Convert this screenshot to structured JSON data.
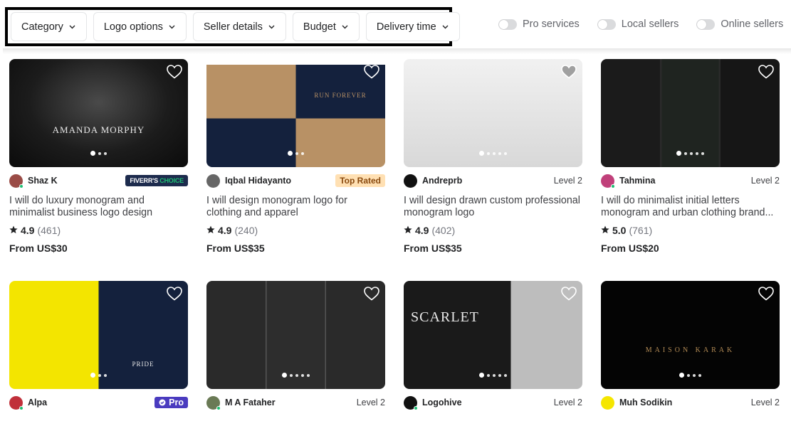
{
  "filters": {
    "buttons": [
      {
        "label": "Category"
      },
      {
        "label": "Logo options"
      },
      {
        "label": "Seller details"
      },
      {
        "label": "Budget"
      },
      {
        "label": "Delivery time"
      }
    ],
    "toggles": [
      {
        "label": "Pro services",
        "on": false
      },
      {
        "label": "Local sellers",
        "on": false
      },
      {
        "label": "Online sellers",
        "on": false
      }
    ]
  },
  "gigs": [
    {
      "seller": "Shaz K",
      "badge_type": "choice",
      "badge": {
        "a": "FIVERR'S",
        "b": "CHOICE"
      },
      "online": true,
      "title": "I will do luxury monogram and minimalist business logo design",
      "rating": "4.9",
      "reviews": "(461)",
      "price": "From US$30",
      "image_text": "AMANDA MORPHY",
      "dots": 3
    },
    {
      "seller": "Iqbal Hidayanto",
      "badge_type": "top",
      "badge": {
        "a": "Top Rated"
      },
      "online": false,
      "title": "I will design monogram logo for clothing and apparel",
      "rating": "4.9",
      "reviews": "(240)",
      "price": "From US$35",
      "image_text": "RUN FOREVER",
      "dots": 3
    },
    {
      "seller": "Andreprb",
      "badge_type": "level",
      "badge": {
        "a": "Level 2"
      },
      "online": false,
      "title": "I will design drawn custom professional monogram logo",
      "rating": "4.9",
      "reviews": "(402)",
      "price": "From US$35",
      "image_text": "",
      "dots": 5
    },
    {
      "seller": "Tahmina",
      "badge_type": "level",
      "badge": {
        "a": "Level 2"
      },
      "online": true,
      "title": "I will do minimalist initial letters monogram and urban clothing brand...",
      "rating": "5.0",
      "reviews": "(761)",
      "price": "From US$20",
      "image_text": "",
      "dots": 5
    },
    {
      "seller": "Alpa",
      "badge_type": "pro",
      "badge": {
        "a": "Pro"
      },
      "online": true,
      "image_text": "PRIDE",
      "dots": 3
    },
    {
      "seller": "M A Fataher",
      "badge_type": "level",
      "badge": {
        "a": "Level 2"
      },
      "online": true,
      "image_text": "",
      "dots": 5
    },
    {
      "seller": "Logohive",
      "badge_type": "level",
      "badge": {
        "a": "Level 2"
      },
      "online": true,
      "image_text": "SCARLET",
      "dots": 5
    },
    {
      "seller": "Muh Sodikin",
      "badge_type": "level",
      "badge": {
        "a": "Level 2"
      },
      "online": false,
      "image_text": "MAISON KARAK",
      "dots": 4
    }
  ],
  "colors": {
    "online": "#1dbf73",
    "choice_bg": "#1d2b4d",
    "top_rated_bg": "#ffe0b3",
    "pro_bg": "#4a3bbf"
  }
}
